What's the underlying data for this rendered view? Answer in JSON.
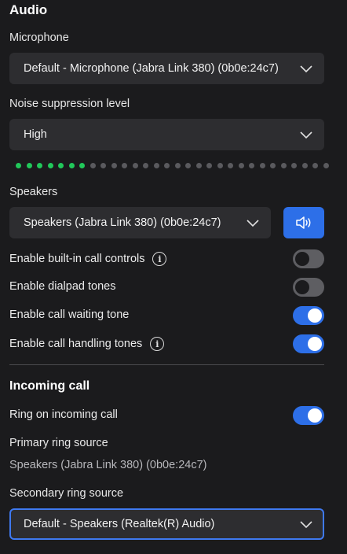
{
  "audio": {
    "heading": "Audio",
    "microphone": {
      "label": "Microphone",
      "value": "Default - Microphone (Jabra Link 380) (0b0e:24c7)"
    },
    "noise": {
      "label": "Noise suppression level",
      "value": "High"
    },
    "level_meter": {
      "active_dots": 7,
      "total_dots": 30,
      "active_color": "#21c85a",
      "inactive_color": "#5a5a5e"
    },
    "speakers": {
      "label": "Speakers",
      "value": "Speakers (Jabra Link 380) (0b0e:24c7)",
      "test_icon": "speaker-icon"
    },
    "toggles": [
      {
        "label": "Enable built-in call controls",
        "on": false,
        "info": true
      },
      {
        "label": "Enable dialpad tones",
        "on": false,
        "info": false
      },
      {
        "label": "Enable call waiting tone",
        "on": true,
        "info": false
      },
      {
        "label": "Enable call handling tones",
        "on": true,
        "info": true
      }
    ]
  },
  "incoming": {
    "heading": "Incoming call",
    "ring_toggle": {
      "label": "Ring on incoming call",
      "on": true
    },
    "primary": {
      "label": "Primary ring source",
      "value": "Speakers (Jabra Link 380) (0b0e:24c7)"
    },
    "secondary": {
      "label": "Secondary ring source",
      "value": "Default - Speakers (Realtek(R) Audio)"
    }
  },
  "colors": {
    "accent": "#2d6fe8",
    "background": "#1b1b1d",
    "field": "#2d2d30"
  }
}
